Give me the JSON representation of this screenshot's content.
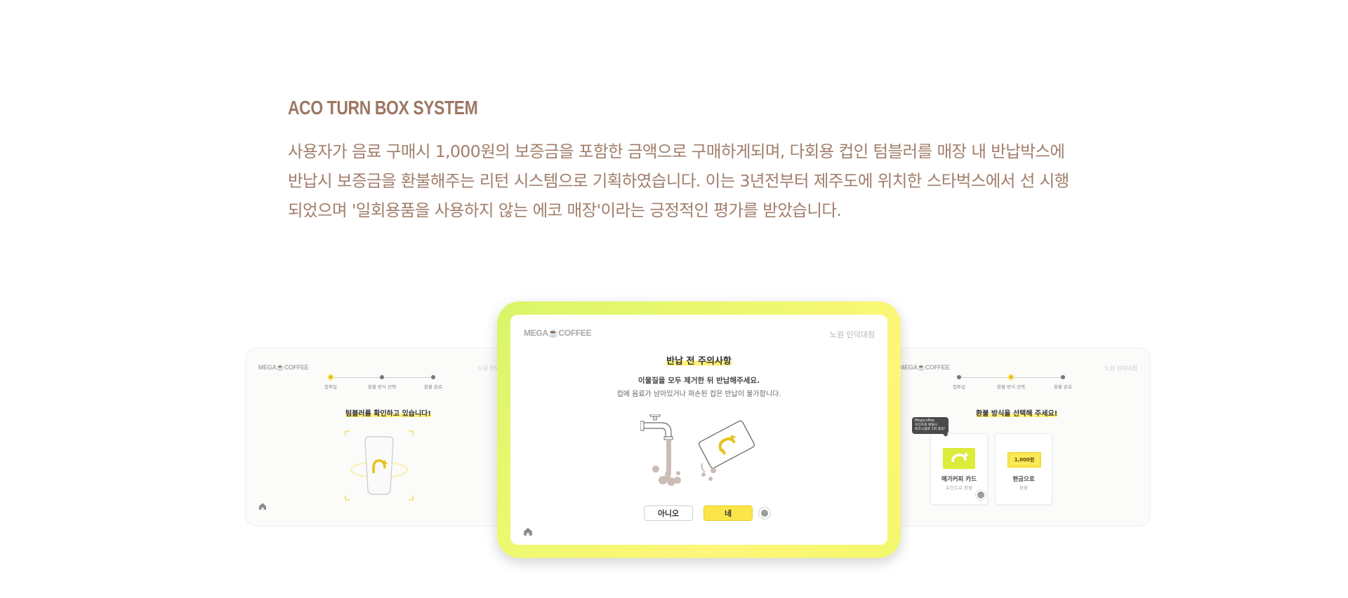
{
  "section": {
    "title": "ACO TURN BOX SYSTEM",
    "description_lines": [
      "사용자가 음료 구매시 1,000원의 보증금을 포함한 금액으로 구매하게되며, 다회용 컵인 텀블러를 매장 내 반납박스에",
      "반납시 보증금을 환불해주는 리턴 시스템으로 기획하였습니다. 이는 3년전부터 제주도에 위치한 스타벅스에서 선 시행",
      "되었으며 '일회용품을 사용하지 않는 에코 매장'이라는 긍정적인 평가를 받았습니다."
    ]
  },
  "left_screen": {
    "logo": "MEGA☕COFFEE",
    "store": "노원 인덕대점",
    "steps": [
      "컵투입",
      "환불 방식 선택",
      "환불 완료"
    ],
    "active_step": 0,
    "heading": "텀블러를 확인하고 있습니다!",
    "icons": [
      "tumbler-icon",
      "home-icon"
    ]
  },
  "main_screen": {
    "logo": "MEGA☕COFFEE",
    "store": "노원 인덕대점",
    "heading": "반납 전 주의사항",
    "message_primary": "이물질을 모두 제거한 뒤 반납해주세요.",
    "message_secondary": "컵에 음료가 남아있거나 파손된 컵은 반납이 불가합니다.",
    "no_button": "아니오",
    "yes_button": "네",
    "icons": [
      "faucet-icon",
      "pouring-cup-icon",
      "home-icon"
    ]
  },
  "right_screen": {
    "logo": "MEGA☕COFFEE",
    "store": "노원 인덕대점",
    "steps": [
      "컵투입",
      "환불 방식 선택",
      "환불 완료"
    ],
    "active_step": 1,
    "heading": "환불 방식을 선택해 주세요!",
    "tooltip": [
      "Megacoffee",
      "포인트로 환불시",
      "에코스탬프 1회 증정!"
    ],
    "options": [
      {
        "title": "메가커피 카드",
        "subtitle": "포인트로 환불",
        "icon": "mega-card-icon"
      },
      {
        "title": "현금으로",
        "subtitle": "환불",
        "icon": "cash-icon",
        "amount": "1,000원"
      }
    ]
  },
  "colors": {
    "brand_text": "#9c7763",
    "highlight": "#fff17a",
    "accent_yellow": "#fbe64a",
    "tablet_gradient_start": "#d9f56a",
    "tablet_gradient_end": "#fff67a"
  }
}
